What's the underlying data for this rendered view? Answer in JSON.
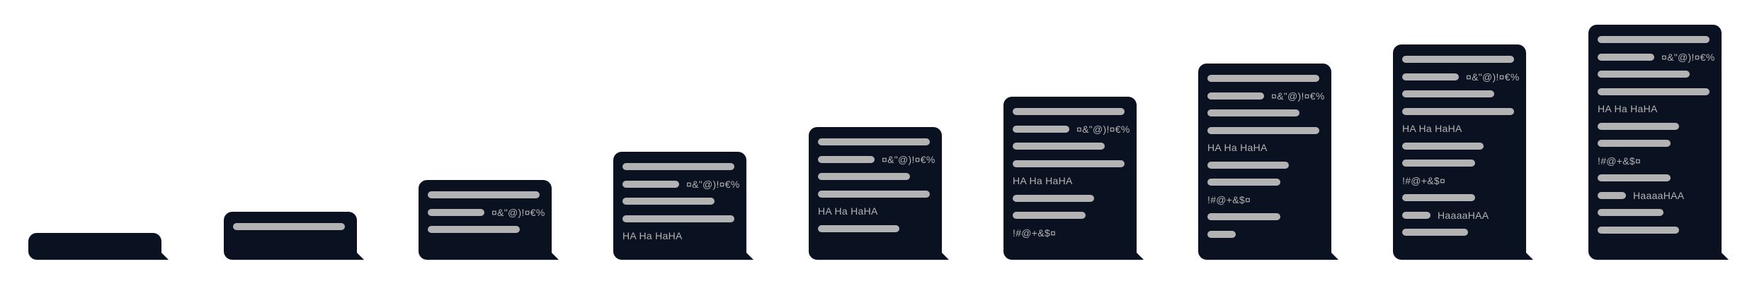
{
  "bubble_color": "#0a1120",
  "line_color": "#b3b3b3",
  "texts": {
    "symbols": "¤&\"@)!¤€%",
    "haha": "HA Ha HaHA",
    "special": "!#@+&$¤",
    "haaaa": "HaaaaHAA"
  }
}
